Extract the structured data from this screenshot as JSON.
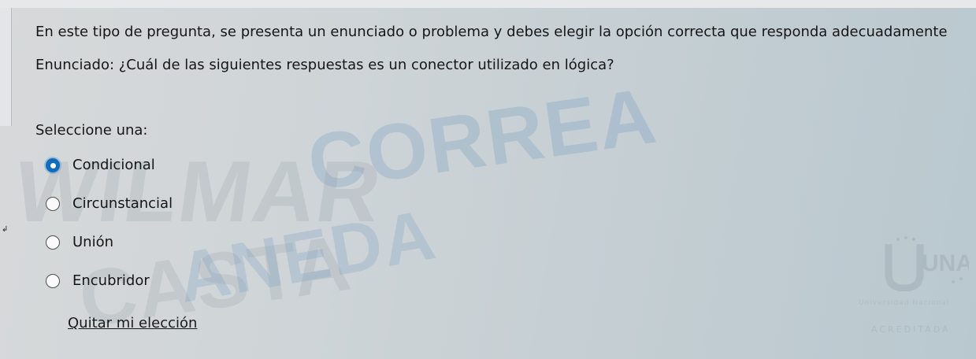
{
  "question": {
    "intro": "En este tipo de pregunta, se presenta un enunciado o problema y debes elegir la opción correcta que responda adecuadamente",
    "statement": "Enunciado: ¿Cuál de las siguientes respuestas es un conector utilizado en lógica?",
    "prompt": "Seleccione una:",
    "options": [
      {
        "label": "Condicional",
        "selected": true
      },
      {
        "label": "Circunstancial",
        "selected": false
      },
      {
        "label": "Unión",
        "selected": false
      },
      {
        "label": "Encubridor",
        "selected": false
      }
    ],
    "clear_label": "Quitar mi elección"
  },
  "watermark": {
    "line1": "WILMAR",
    "line2": "CORREA",
    "line3": "CASTA",
    "line4": "ANEDA"
  },
  "logo": {
    "name": "UNAD",
    "subtitle": "Universidad Nacional",
    "accreditation": "ACREDITADA"
  },
  "colors": {
    "accent": "#0f6cbf",
    "text": "#161616"
  }
}
